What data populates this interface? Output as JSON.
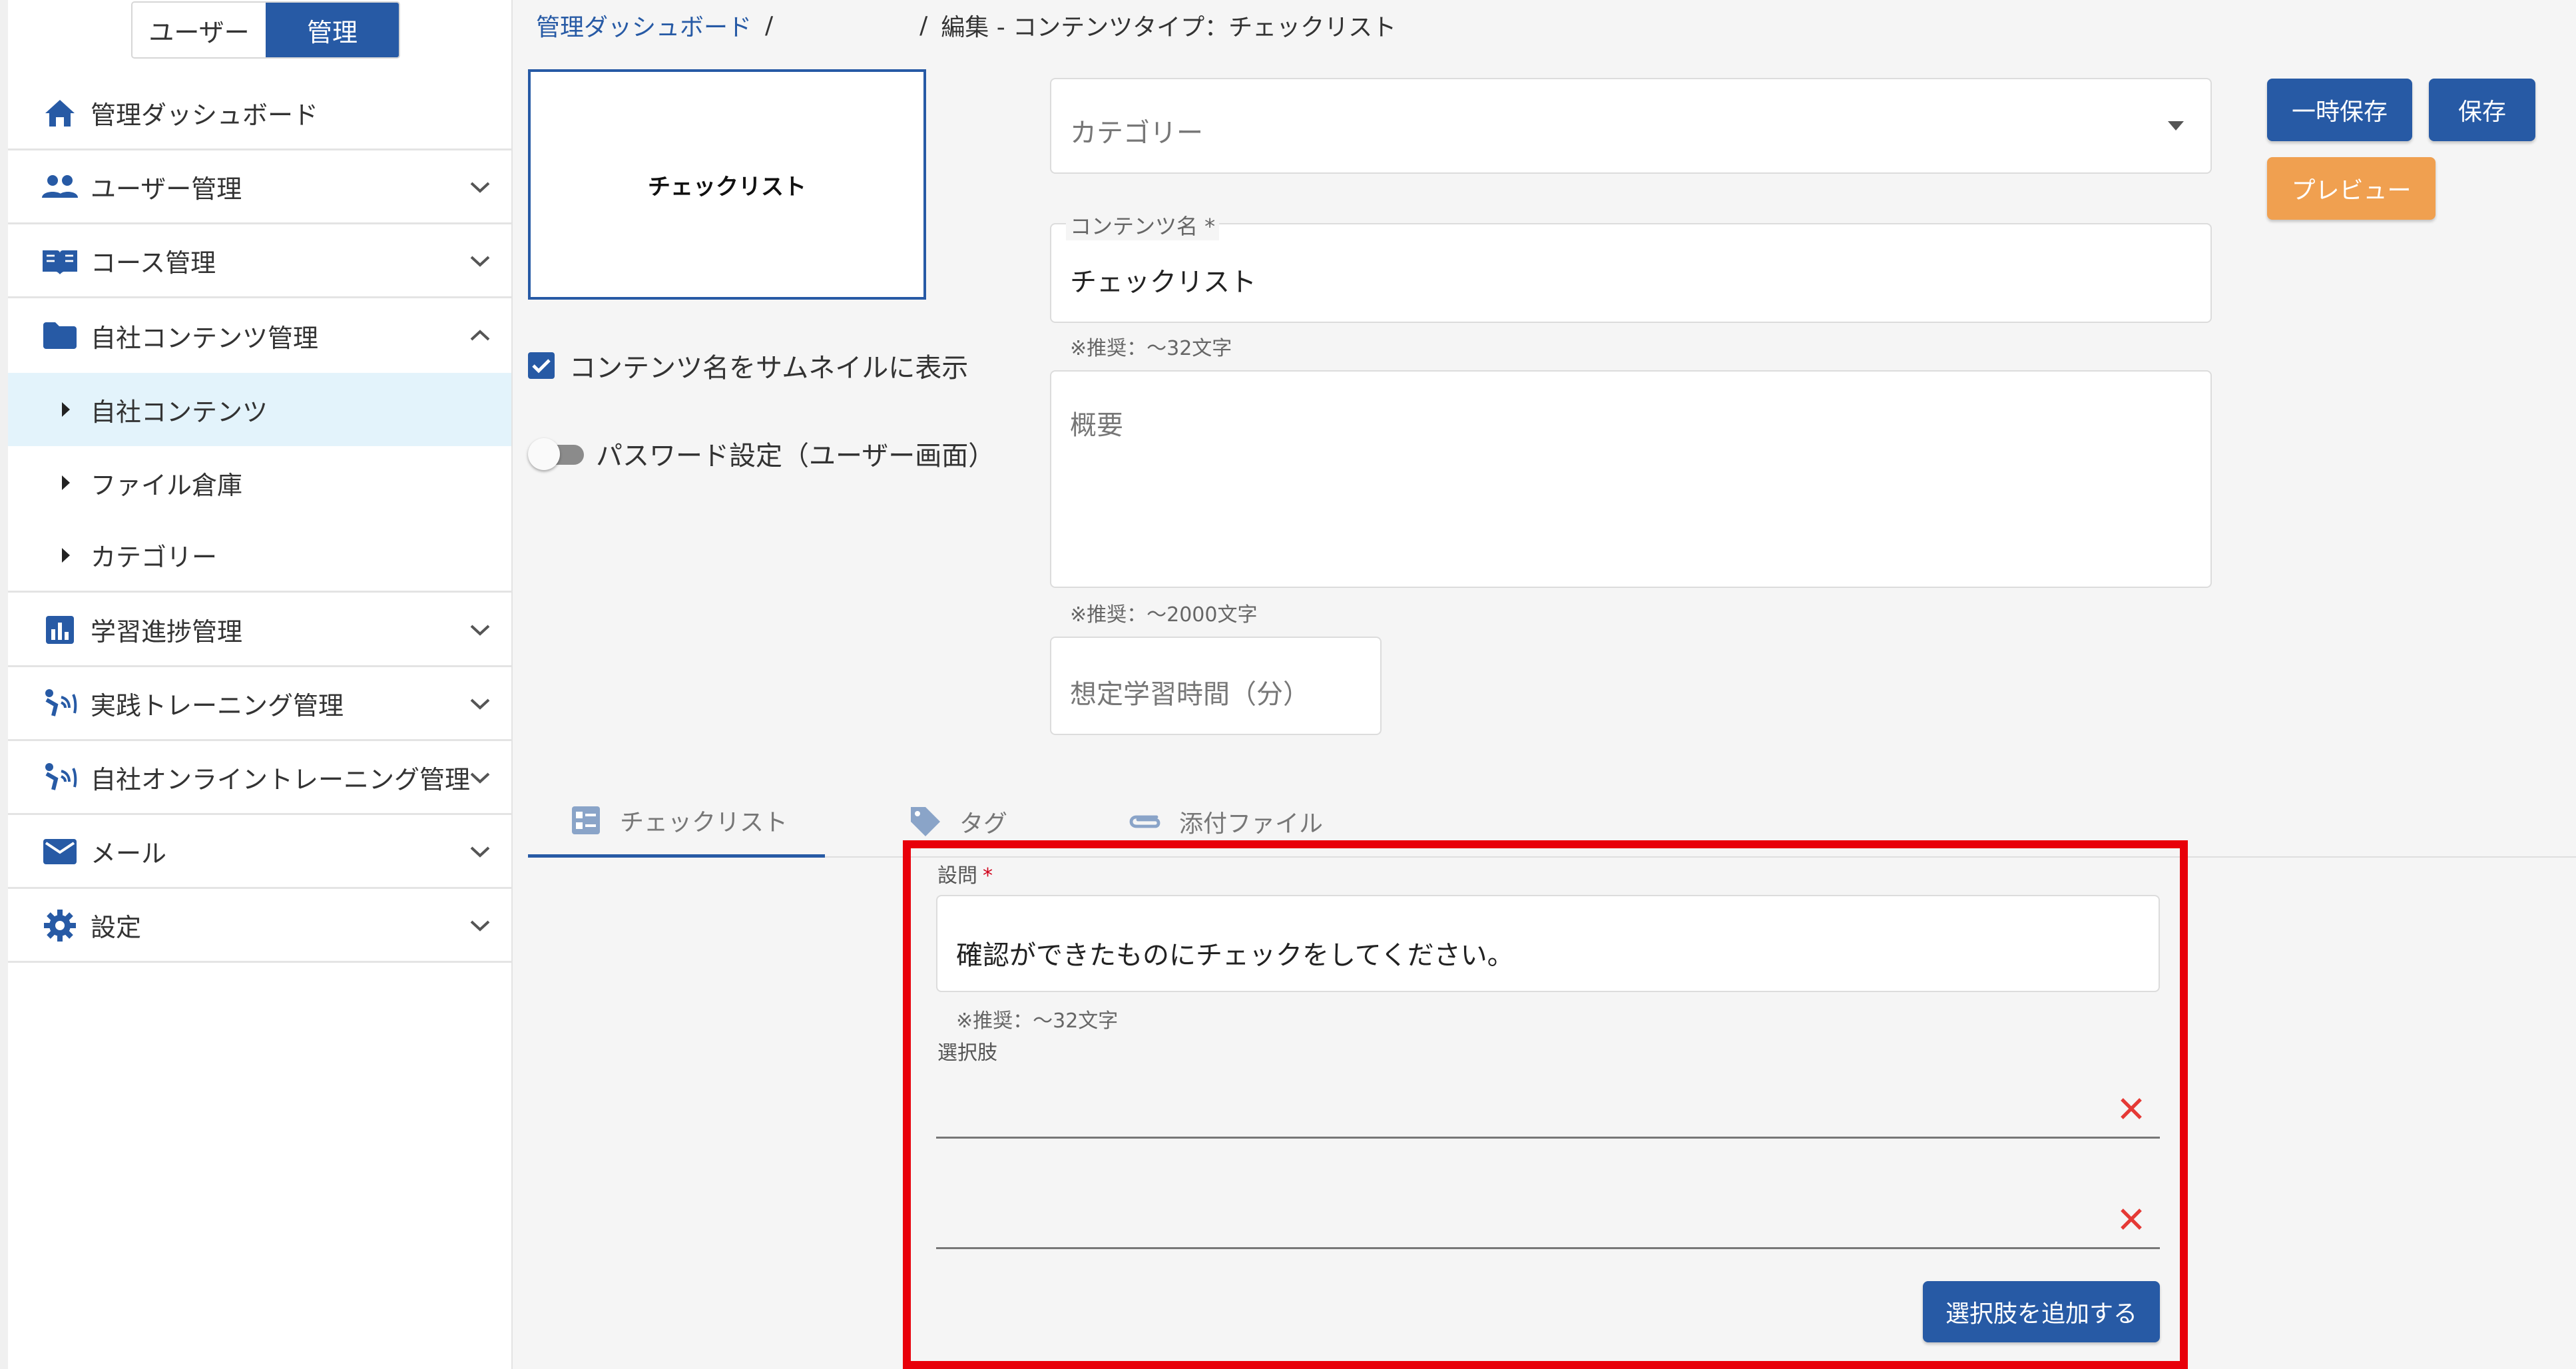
{
  "sidebar": {
    "mode_toggle": {
      "user_label": "ユーザー",
      "admin_label": "管理"
    },
    "items": [
      {
        "label": "管理ダッシュボード",
        "icon": "home-icon"
      },
      {
        "label": "ユーザー管理",
        "icon": "users-icon"
      },
      {
        "label": "コース管理",
        "icon": "book-icon"
      },
      {
        "label": "自社コンテンツ管理",
        "icon": "folder-icon"
      },
      {
        "label": "自社コンテンツ",
        "icon": "caret-right-icon"
      },
      {
        "label": "ファイル倉庫",
        "icon": "caret-right-icon"
      },
      {
        "label": "カテゴリー",
        "icon": "caret-right-icon"
      },
      {
        "label": "学習進捗管理",
        "icon": "chart-icon"
      },
      {
        "label": "実践トレーニング管理",
        "icon": "training-icon"
      },
      {
        "label": "自社オンライントレーニング管理",
        "icon": "online-training-icon"
      },
      {
        "label": "メール",
        "icon": "mail-icon"
      },
      {
        "label": "設定",
        "icon": "gear-icon"
      }
    ]
  },
  "breadcrumb": {
    "home": "管理ダッシュボード",
    "separator": "/",
    "current": "編集 - コンテンツタイプ：チェックリスト"
  },
  "thumbnail": {
    "text": "チェックリスト"
  },
  "options": {
    "show_name_label": "コンテンツ名をサムネイルに表示",
    "show_name_checked": true,
    "password_label": "パスワード設定（ユーザー画面）",
    "password_enabled": false
  },
  "form": {
    "category_placeholder": "カテゴリー",
    "content_name_label": "コンテンツ名 *",
    "content_name_value": "チェックリスト",
    "content_name_hint": "※推奨：～32文字",
    "summary_placeholder": "概要",
    "summary_hint": "※推奨：～2000文字",
    "study_time_placeholder": "想定学習時間（分）"
  },
  "buttons": {
    "temp_save": "一時保存",
    "save": "保存",
    "preview": "プレビュー"
  },
  "tabs": [
    {
      "label": "チェックリスト",
      "icon": "checklist-icon",
      "active": true
    },
    {
      "label": "タグ",
      "icon": "tag-icon",
      "active": false
    },
    {
      "label": "添付ファイル",
      "icon": "paperclip-icon",
      "active": false
    }
  ],
  "question": {
    "label": "設問",
    "required_mark": "*",
    "value": "確認ができたものにチェックをしてください。",
    "hint": "※推奨：～32文字",
    "choices_label": "選択肢",
    "choices": [
      "",
      ""
    ],
    "add_choice_label": "選択肢を追加する"
  },
  "colors": {
    "primary": "#275aa5",
    "preview": "#f0a050",
    "highlight": "#e8000a",
    "delete": "#e53935",
    "selected_bg": "#e3f3fb"
  }
}
